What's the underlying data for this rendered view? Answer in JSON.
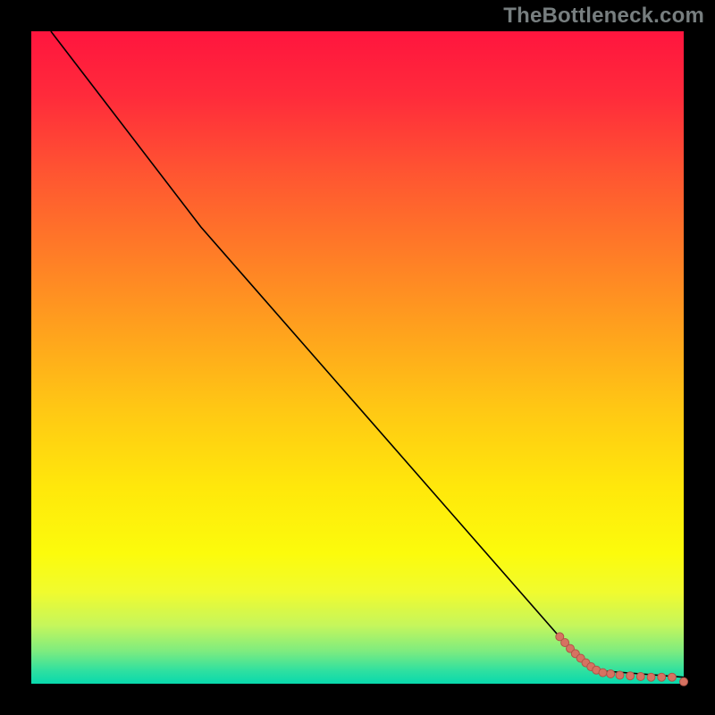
{
  "watermark": "TheBottleneck.com",
  "colors": {
    "marker_fill": "#d67261",
    "marker_stroke": "#b05348",
    "curve": "#000000",
    "frame": "#000000",
    "gradient_top": "#ff153e",
    "gradient_bottom": "#08d9ad"
  },
  "chart_data": {
    "type": "line",
    "title": "",
    "xlabel": "",
    "ylabel": "",
    "xlim": [
      0,
      100
    ],
    "ylim": [
      0,
      100
    ],
    "grid": false,
    "legend": false,
    "curve": [
      {
        "x": 3,
        "y": 100
      },
      {
        "x": 26,
        "y": 70
      },
      {
        "x": 82,
        "y": 6
      },
      {
        "x": 87,
        "y": 2
      },
      {
        "x": 100,
        "y": 1
      }
    ],
    "markers": [
      {
        "x": 81.0,
        "y": 7.2
      },
      {
        "x": 81.8,
        "y": 6.3
      },
      {
        "x": 82.6,
        "y": 5.4
      },
      {
        "x": 83.4,
        "y": 4.6
      },
      {
        "x": 84.2,
        "y": 3.9
      },
      {
        "x": 85.0,
        "y": 3.2
      },
      {
        "x": 85.8,
        "y": 2.6
      },
      {
        "x": 86.6,
        "y": 2.1
      },
      {
        "x": 87.6,
        "y": 1.7
      },
      {
        "x": 88.8,
        "y": 1.5
      },
      {
        "x": 90.2,
        "y": 1.3
      },
      {
        "x": 91.8,
        "y": 1.2
      },
      {
        "x": 93.4,
        "y": 1.1
      },
      {
        "x": 95.0,
        "y": 1.0
      },
      {
        "x": 96.6,
        "y": 1.0
      },
      {
        "x": 98.2,
        "y": 1.0
      },
      {
        "x": 100.0,
        "y": 0.3
      }
    ]
  }
}
